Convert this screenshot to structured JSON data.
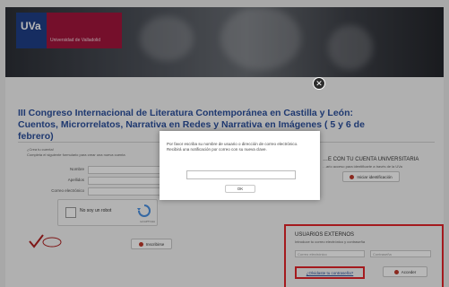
{
  "logo": {
    "short": "UVa",
    "name": "Universidad de Valladolid"
  },
  "title": "III Congreso Internacional de Literatura Contemporánea en Castilla y León: Cuentos, Microrrelatos, Narrativa en Redes y Narrativa en Imágenes ( 5 y 6 de febrero)",
  "left": {
    "heading": "¿Crea tu cuenta!",
    "subtitle": "Completa el siguiente formulario para crear una nueva cuenta",
    "fields": [
      "Nombre",
      "Apellidos",
      "Correo electrónico"
    ],
    "captcha": {
      "label": "No soy un robot",
      "brand": "reCAPTCHA"
    },
    "register_label": "Inscribirse"
  },
  "right": {
    "uni_heading": "…E CON TU CUENTA UNIVERSITARIA",
    "uni_subtitle": "…ario acceso para identificarte a través de la UVa",
    "uni_button": "Iniciar identificación",
    "ext_heading": "USUARIOS EXTERNOS",
    "ext_subtitle": "Introduce tu correo electrónico y contraseña",
    "email_placeholder": "Correo electrónico",
    "password_placeholder": "Contraseña",
    "forgot_label": "¿Olvidaste tu contraseña?",
    "login_label": "Acceder"
  },
  "modal": {
    "message": "Por favor escriba su nombre de usuario o dirección de correo electrónico. Recibirá una notificación por correo con su nueva clave.",
    "ok_label": "OK",
    "close_glyph": "✕"
  },
  "colors": {
    "accent_blue": "#2b4f9c",
    "brand_red": "#a3163c",
    "highlight": "#e3252a"
  }
}
